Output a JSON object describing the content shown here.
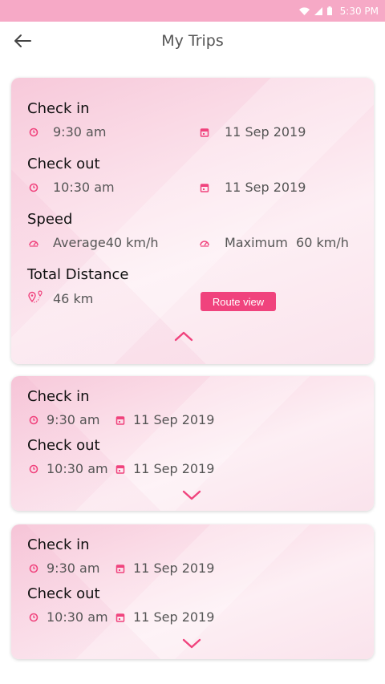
{
  "status_bar": {
    "time": "5:30 PM"
  },
  "header": {
    "title": "My Trips"
  },
  "trip_expanded": {
    "checkin_label": "Check in",
    "checkin_time": "9:30 am",
    "checkin_date": "11 Sep 2019",
    "checkout_label": "Check out",
    "checkout_time": "10:30 am",
    "checkout_date": "11 Sep 2019",
    "speed_label": "Speed",
    "speed_average": "Average40 km/h",
    "speed_maximum": "Maximum  60 km/h",
    "distance_label": "Total Distance",
    "distance_value": "46 km",
    "route_button": "Route view"
  },
  "trips_collapsed": [
    {
      "checkin_label": "Check in",
      "checkin_time": "9:30 am",
      "checkin_date": "11 Sep 2019",
      "checkout_label": "Check out",
      "checkout_time": "10:30 am",
      "checkout_date": "11 Sep 2019"
    },
    {
      "checkin_label": "Check in",
      "checkin_time": "9:30 am",
      "checkin_date": "11 Sep 2019",
      "checkout_label": "Check out",
      "checkout_time": "10:30 am",
      "checkout_date": "11 Sep 2019"
    }
  ],
  "colors": {
    "accent": "#f0437d",
    "status_bar": "#f6a9c6"
  },
  "icons": [
    "arrow-back-icon",
    "clock-icon",
    "calendar-icon",
    "speedometer-icon",
    "route-pin-icon",
    "chevron-up-icon",
    "chevron-down-icon",
    "wifi-icon",
    "signal-icon",
    "battery-icon"
  ]
}
